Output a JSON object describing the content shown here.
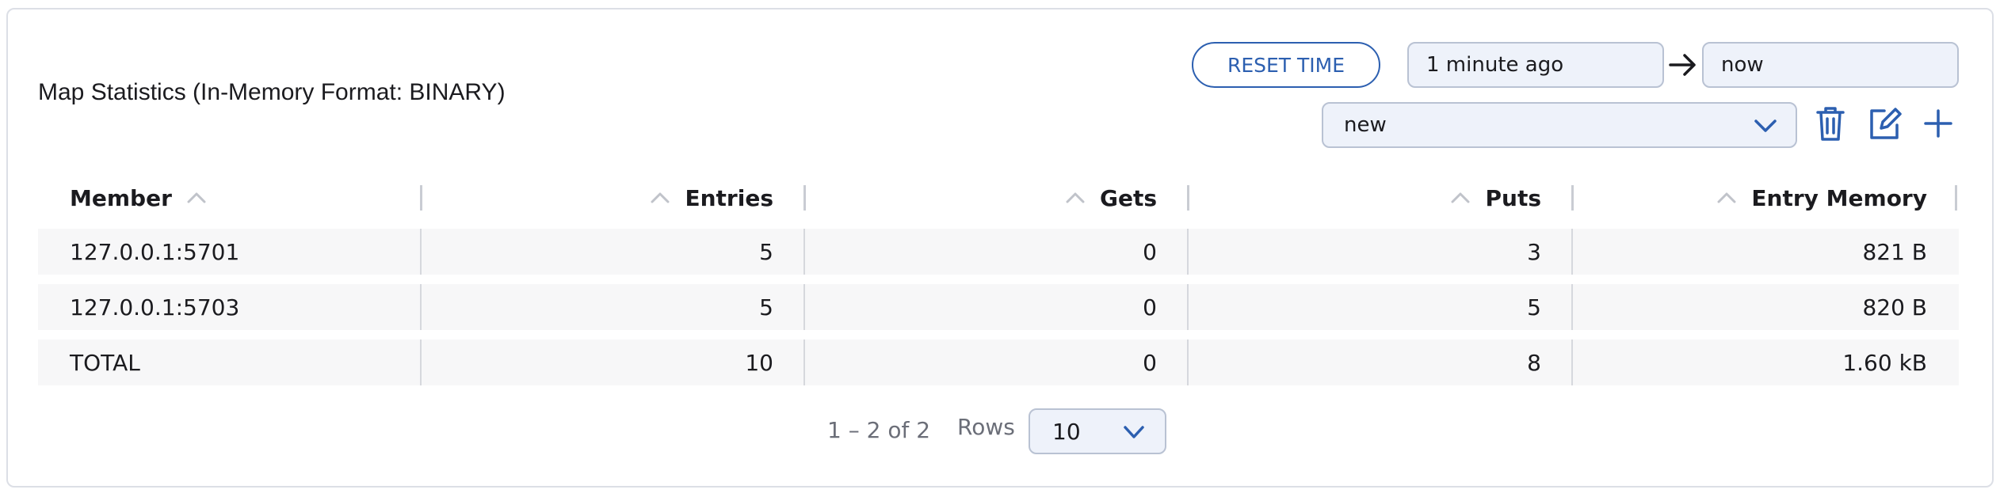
{
  "panel": {
    "title": "Map Statistics (In-Memory Format: BINARY)"
  },
  "toolbar": {
    "reset_time_label": "RESET TIME",
    "time_from_value": "1 minute ago",
    "time_to_value": "now",
    "preset_select_value": "new",
    "icons": [
      "arrow-right-icon",
      "chevron-down-icon",
      "trash-icon",
      "edit-icon",
      "plus-icon"
    ]
  },
  "table": {
    "columns": [
      {
        "label": "Member",
        "align": "left",
        "sort_icon": "chevron-up-icon"
      },
      {
        "label": "Entries",
        "align": "right",
        "sort_icon": "chevron-up-icon"
      },
      {
        "label": "Gets",
        "align": "right",
        "sort_icon": "chevron-up-icon"
      },
      {
        "label": "Puts",
        "align": "right",
        "sort_icon": "chevron-up-icon"
      },
      {
        "label": "Entry Memory",
        "align": "right",
        "sort_icon": "chevron-up-icon"
      }
    ],
    "rows": [
      [
        "127.0.0.1:5701",
        "5",
        "0",
        "3",
        "821 B"
      ],
      [
        "127.0.0.1:5703",
        "5",
        "0",
        "5",
        "820 B"
      ],
      [
        "TOTAL",
        "10",
        "0",
        "8",
        "1.60 kB"
      ]
    ]
  },
  "pagination": {
    "range_text": "1 – 2 of 2",
    "rows_label": "Rows",
    "rows_per_page": "10"
  },
  "colors": {
    "accent": "#2c5fb0",
    "field_bg": "#eef2fa",
    "row_bg": "#f7f7f8"
  }
}
